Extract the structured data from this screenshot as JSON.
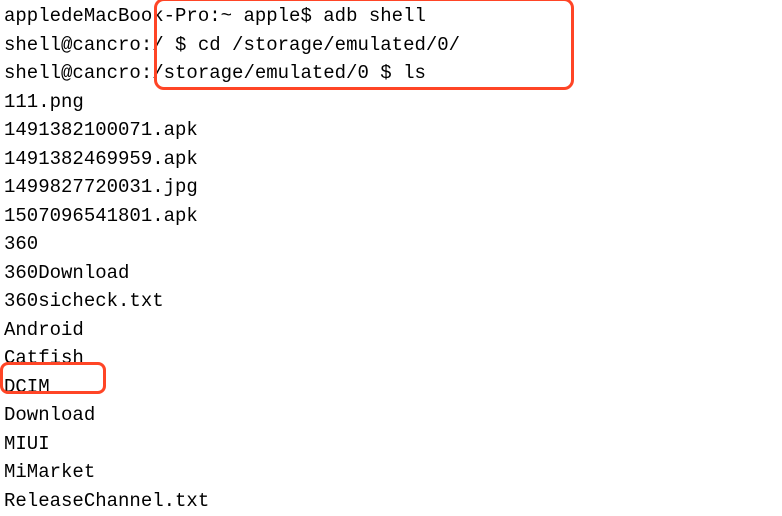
{
  "lines": {
    "l1_prompt": "appledeMacBook-Pro:~ apple$ ",
    "l1_command": "adb shell",
    "l2_prompt": "shell@cancro:/ $ ",
    "l2_command": "cd /storage/emulated/0/",
    "l3_prompt": "shell@cancro:/storage/emulated/0 $ ",
    "l3_command": "ls"
  },
  "ls_output": [
    "111.png",
    "1491382100071.apk",
    "1491382469959.apk",
    "1499827720031.jpg",
    "1507096541801.apk",
    "360",
    "360Download",
    "360sicheck.txt",
    "Android",
    "Catfish",
    "DCIM",
    "Download",
    "MIUI",
    "MiMarket",
    "ReleaseChannel.txt"
  ]
}
